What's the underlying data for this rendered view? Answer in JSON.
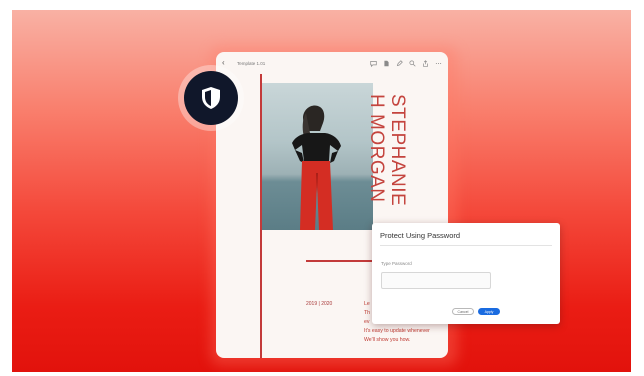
{
  "tablet": {
    "toolbar": {
      "back_icon": "chevron-left-icon",
      "title": "Template 1.01",
      "icons": [
        "comment-icon",
        "file-icon",
        "pen-icon",
        "search-icon",
        "share-icon",
        "more-icon"
      ]
    },
    "name": {
      "first": "STEPHANIE",
      "last": "H MORGAN"
    },
    "years": "2019 | 2020",
    "body_lines": [
      "Le",
      "Th",
      "ev",
      "It's easy to update whenever",
      "We'll show you how."
    ]
  },
  "badge": {
    "icon": "shield-icon"
  },
  "dialog": {
    "title": "Protect Using Password",
    "field_label": "Type Password",
    "field_value": "",
    "cancel_label": "Cancel",
    "apply_label": "Apply"
  },
  "colors": {
    "background_top": "#f9b1a4",
    "background_bottom": "#e2120c",
    "accent_red": "#c4443e",
    "shield_bg": "#10172a",
    "apply_blue": "#1a6be0"
  }
}
